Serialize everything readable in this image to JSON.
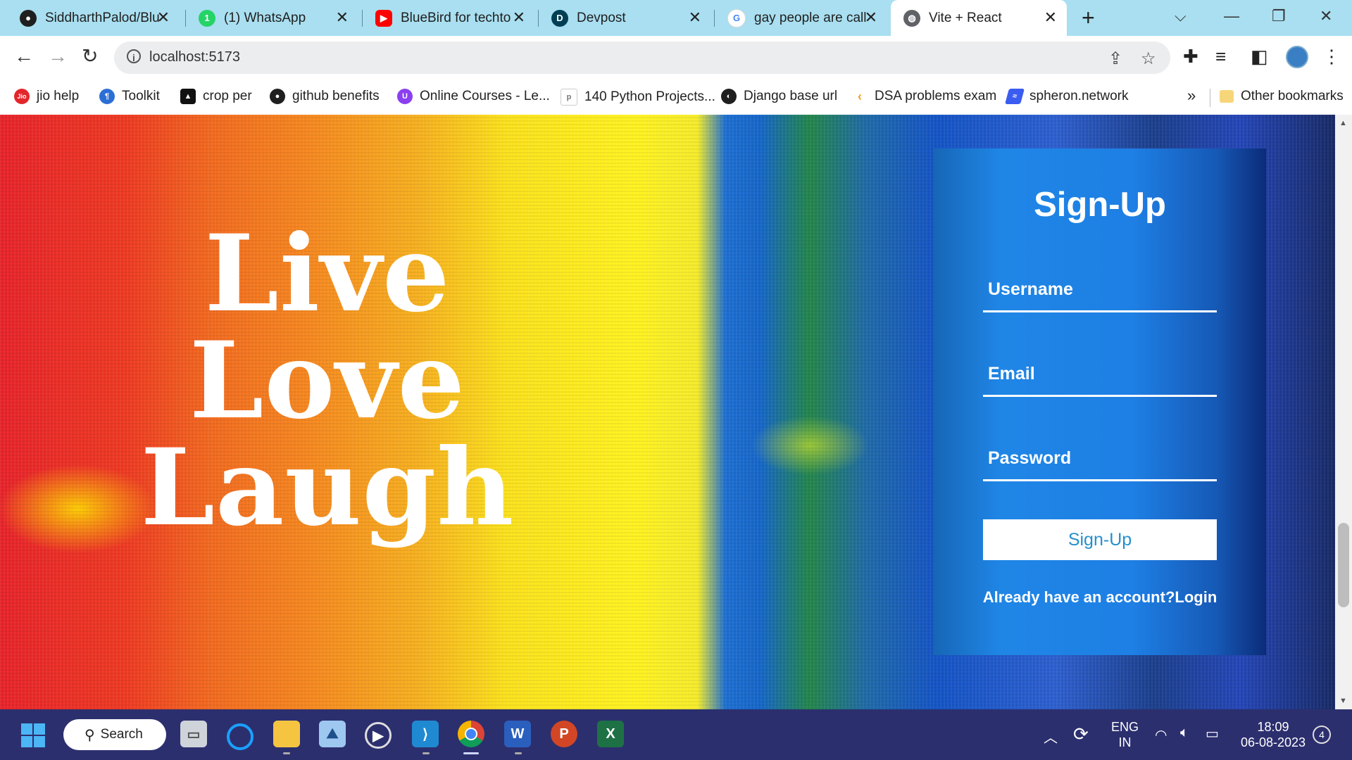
{
  "browser": {
    "tabs": [
      {
        "title": "SiddharthPalod/Blu",
        "icon": "github-icon",
        "icon_color": "#1f1f1f"
      },
      {
        "title": "(1) WhatsApp",
        "icon": "whatsapp-icon",
        "icon_color": "#25d366",
        "badge": "1"
      },
      {
        "title": "BlueBird for techto",
        "icon": "youtube-icon",
        "icon_color": "#ff0000"
      },
      {
        "title": "Devpost",
        "icon": "devpost-icon",
        "icon_color": "#003e54",
        "badge": "D"
      },
      {
        "title": "gay people are call",
        "icon": "google-icon",
        "icon_color": "#4285f4",
        "badge": "G"
      },
      {
        "title": "Vite + React",
        "icon": "globe-icon",
        "icon_color": "#5f6368",
        "active": true
      }
    ],
    "url": "localhost:5173",
    "bookmarks": [
      {
        "label": "jio help",
        "icon": "jio-icon",
        "icon_color": "#e3262b",
        "badge": "Jio"
      },
      {
        "label": "Toolkit",
        "icon": "toolkit-icon",
        "icon_color": "#2b6fd6"
      },
      {
        "label": "crop per",
        "icon": "crop-icon",
        "icon_color": "#111111"
      },
      {
        "label": "github benefits",
        "icon": "github-icon",
        "icon_color": "#1f1f1f"
      },
      {
        "label": "Online Courses - Le...",
        "icon": "courses-icon",
        "icon_color": "#8a3ff0"
      },
      {
        "label": "140 Python Projects...",
        "icon": "python-icon",
        "icon_color": "#777777"
      },
      {
        "label": "Django base url",
        "icon": "django-icon",
        "icon_color": "#1f1f1f"
      },
      {
        "label": "DSA problems exam",
        "icon": "dsa-icon",
        "icon_color": "#f0a020"
      },
      {
        "label": "spheron.network",
        "icon": "spheron-icon",
        "icon_color": "#3a5cf0"
      }
    ],
    "more_bookmarks": "»",
    "other_bookmarks": "Other bookmarks"
  },
  "page": {
    "hero_lines": [
      "Live",
      "Love",
      "Laugh"
    ],
    "signup": {
      "title": "Sign-Up",
      "username_placeholder": "Username",
      "email_placeholder": "Email",
      "password_placeholder": "Password",
      "button_label": "Sign-Up",
      "login_prompt": "Already have an account?",
      "login_link": "Login"
    }
  },
  "taskbar": {
    "search_label": "Search",
    "apps": [
      "file-explorer-icon",
      "cortana-icon",
      "folder-icon",
      "photos-icon",
      "media-player-icon",
      "vscode-icon",
      "chrome-icon",
      "word-icon",
      "powerpoint-icon",
      "excel-icon"
    ],
    "language_line1": "ENG",
    "language_line2": "IN",
    "time": "18:09",
    "date": "06-08-2023",
    "notifications": "4"
  }
}
